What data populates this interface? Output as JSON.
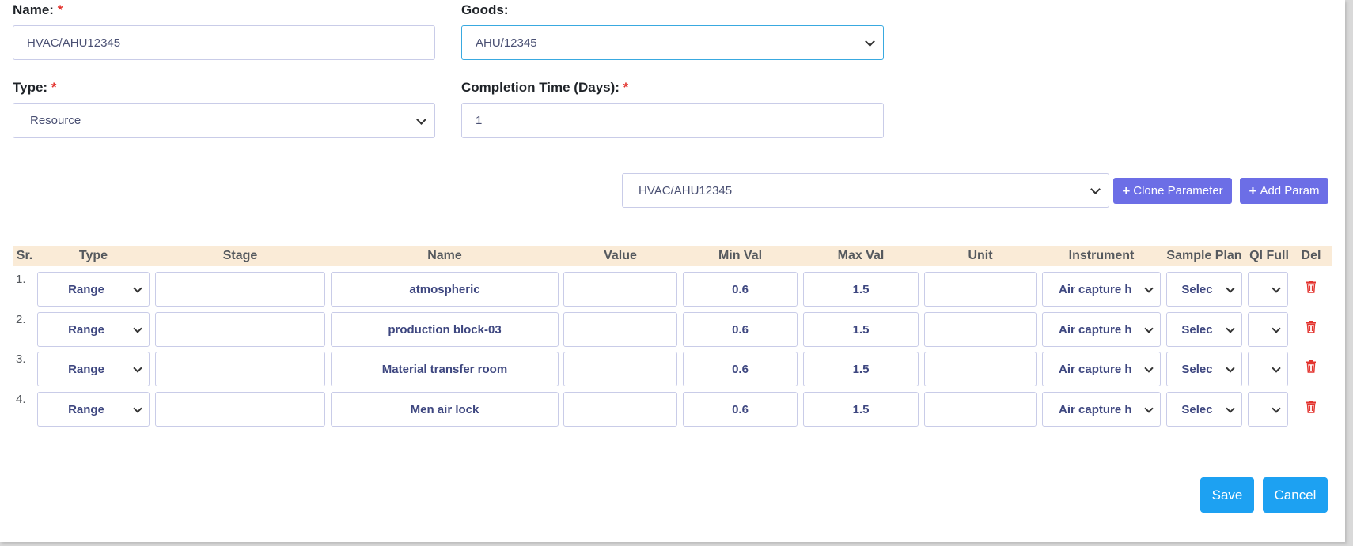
{
  "form": {
    "name_label": "Name:",
    "name_value": "HVAC/AHU12345",
    "goods_label": "Goods:",
    "goods_value": "AHU/12345",
    "type_label": "Type:",
    "type_value": "Resource",
    "completion_label": "Completion Time (Days):",
    "completion_value": "1",
    "required_mark": "*"
  },
  "clone": {
    "select_value": "HVAC/AHU12345",
    "clone_button": "Clone Parameter",
    "add_button": "Add Param",
    "plus_icon": "+"
  },
  "table": {
    "headers": [
      "Sr.",
      "Type",
      "Stage",
      "Name",
      "Value",
      "Min Val",
      "Max Val",
      "Unit",
      "Instrument",
      "Sample Plan",
      "QI Full",
      "Del"
    ],
    "rows": [
      {
        "sr": "1.",
        "type": "Range",
        "stage": "",
        "name": "atmospheric",
        "value": "",
        "min": "0.6",
        "max": "1.5",
        "unit": "",
        "instrument": "Air capture h",
        "sample_plan": "Selec",
        "qi_full": ""
      },
      {
        "sr": "2.",
        "type": "Range",
        "stage": "",
        "name": "production block-03",
        "value": "",
        "min": "0.6",
        "max": "1.5",
        "unit": "",
        "instrument": "Air capture h",
        "sample_plan": "Selec",
        "qi_full": ""
      },
      {
        "sr": "3.",
        "type": "Range",
        "stage": "",
        "name": "Material transfer room",
        "value": "",
        "min": "0.6",
        "max": "1.5",
        "unit": "",
        "instrument": "Air capture h",
        "sample_plan": "Selec",
        "qi_full": ""
      },
      {
        "sr": "4.",
        "type": "Range",
        "stage": "",
        "name": "Men air lock",
        "value": "",
        "min": "0.6",
        "max": "1.5",
        "unit": "",
        "instrument": "Air capture h",
        "sample_plan": "Selec",
        "qi_full": ""
      }
    ]
  },
  "actions": {
    "save": "Save",
    "cancel": "Cancel"
  },
  "icons": {
    "delete": "trash-icon",
    "select": "chevron-down-icon"
  },
  "colors": {
    "accent_purple": "#6c6ee6",
    "button_blue": "#1da1f2",
    "header_bg": "#faebd7",
    "required": "#e3342f",
    "delete": "#e3342f"
  }
}
